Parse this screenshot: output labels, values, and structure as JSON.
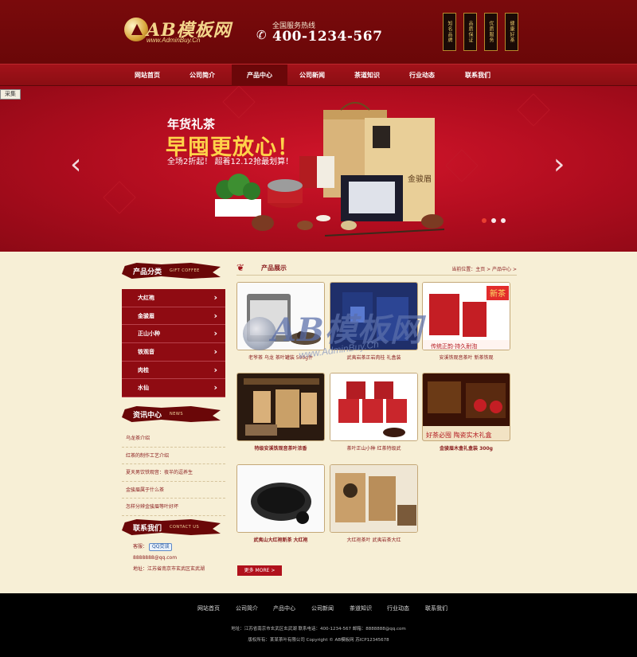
{
  "header": {
    "logo_text": "AB模板网",
    "logo_sub": "www.AdminBuy.Cn",
    "hotline_label": "全国服务热线",
    "hotline_number": "400-1234-567",
    "badges": [
      "知名品牌",
      "品质保证",
      "优质服务",
      "健康好茶"
    ]
  },
  "nav": {
    "items": [
      "网站首页",
      "公司简介",
      "产品中心",
      "公司新闻",
      "茶道知识",
      "行业动态",
      "联系我们"
    ],
    "active_index": 2
  },
  "corner_tag": "采集",
  "banner": {
    "subtitle": "年货礼茶",
    "title": "早囤更放心！",
    "promo": "全场2折起！ 超着12.12抢最划算！",
    "prev_icon": "chevron-left-icon",
    "next_icon": "chevron-right-icon",
    "active_slide": 1
  },
  "sidebar": {
    "products_title": "产品分类",
    "products_en": "GIFT COFFEE",
    "categories": [
      "大红袍",
      "金骏眉",
      "正山小种",
      "铁观音",
      "肉桂",
      "水仙"
    ],
    "news_title": "资讯中心",
    "news_en": "NEWS",
    "news": [
      "乌龙茶介绍",
      "红茶的制作工艺介绍",
      "夏天男饮铁观音：夜半的逗养生",
      "金骏眉属于什么茶",
      "怎样分辨金骏眉等叶好坏"
    ],
    "contact_title": "联系我们",
    "contact_en": "CONTACT US",
    "qq_label": "客服：",
    "qq_button": "QQ交谈",
    "email": "8888888@qq.com",
    "address": "地址：江苏省南京市玄武区玄武湖"
  },
  "main": {
    "title": "产品展示",
    "breadcrumb": "当前位置：主页 > 产品中心 >",
    "products": [
      {
        "name": "老爷茶 乌龙 茶叶罐装 500g件",
        "bold": false
      },
      {
        "name": "武夷岩茶正岩肉桂 礼盒装",
        "bold": false
      },
      {
        "name": "安溪铁观音茶叶 新茶铁观",
        "bold": false
      },
      {
        "name": "特级安溪铁观音茶叶浓香",
        "bold": true
      },
      {
        "name": "茶叶正山小种 红茶特级武",
        "bold": false
      },
      {
        "name": "金骏眉木盒礼盒装 300g",
        "bold": true
      },
      {
        "name": "武夷山大红袍新茶 大红袍",
        "bold": true
      },
      {
        "name": "大红袍茶叶 武夷岩茶大红",
        "bold": false
      }
    ],
    "more": "更多 MORE >"
  },
  "watermark": {
    "text": "AB模板网",
    "sub": "www.AdminBuy.Cn"
  },
  "footer": {
    "links": [
      "网站首页",
      "公司简介",
      "产品中心",
      "公司新闻",
      "茶道知识",
      "行业动态",
      "联系我们"
    ],
    "line1": "地址：江苏省南京市玄武区玄武湖   联系电话：400-1234-567   邮箱：8888888@qq.com",
    "line2": "版权所有：某某茶叶有限公司   Copyright © AB模板网   苏ICP12345678"
  },
  "colors": {
    "header": "#7a0a0c",
    "nav": "#a3121a",
    "sidebar_cat": "#8f0b12",
    "page_bg": "#f7efd6",
    "accent_text": "#8b1f20",
    "banner_title": "#ffd24a"
  }
}
